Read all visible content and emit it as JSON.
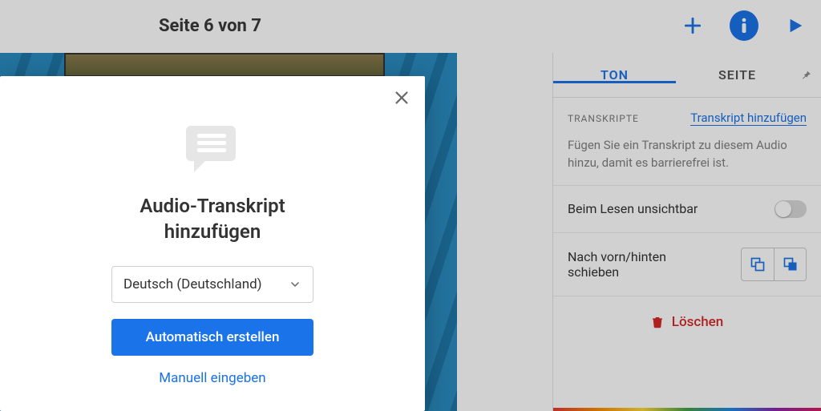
{
  "header": {
    "page_title": "Seite 6 von 7"
  },
  "panel": {
    "tabs": {
      "audio": "TON",
      "page": "SEITE"
    },
    "transcripts_label": "TRANSKRIPTE",
    "add_transcript": "Transkript hinzufügen",
    "hint": "Fügen Sie ein Transkript zu diesem Audio hinzu, damit es barrierefrei ist.",
    "invisible_label": "Beim Lesen unsichtbar",
    "reorder_label": "Nach vorn/hinten schieben",
    "delete_label": "Löschen"
  },
  "modal": {
    "title_line1": "Audio-Transkript",
    "title_line2": "hinzufügen",
    "language_selected": "Deutsch (Deutschland)",
    "auto_button": "Automatisch erstellen",
    "manual_button": "Manuell eingeben"
  }
}
